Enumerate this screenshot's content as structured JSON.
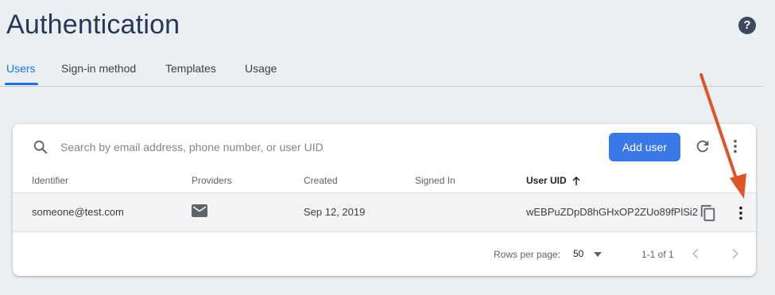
{
  "header": {
    "title": "Authentication",
    "help_icon": "help-circle-icon"
  },
  "tabs": [
    {
      "label": "Users",
      "active": true
    },
    {
      "label": "Sign-in method",
      "active": false
    },
    {
      "label": "Templates",
      "active": false
    },
    {
      "label": "Usage",
      "active": false
    }
  ],
  "toolbar": {
    "search_placeholder": "Search by email address, phone number, or user UID",
    "add_user_label": "Add user",
    "search_icon": "search-icon",
    "refresh_icon": "refresh-icon",
    "more_icon": "more-vert-icon"
  },
  "table": {
    "columns": [
      "Identifier",
      "Providers",
      "Created",
      "Signed In",
      "User UID"
    ],
    "sorted_column": "User UID",
    "sort_direction": "ascending",
    "rows": [
      {
        "identifier": "someone@test.com",
        "provider_icon": "email-icon",
        "created": "Sep 12, 2019",
        "signed_in": "",
        "uid": "wEBPuZDpD8hGHxOP2ZUo89fPlSi2"
      }
    ]
  },
  "pagination": {
    "rows_per_page_label": "Rows per page:",
    "rows_per_page_value": "50",
    "range_text": "1-1 of 1"
  },
  "colors": {
    "accent": "#1a73e8",
    "button": "#3b78e7",
    "title": "#253858",
    "annotation_arrow": "#e0542a"
  }
}
